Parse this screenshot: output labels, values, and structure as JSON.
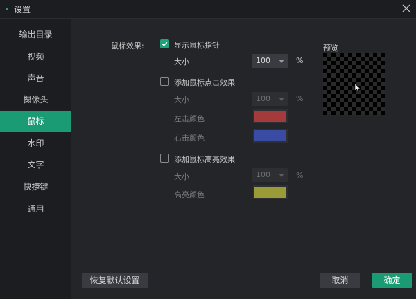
{
  "window": {
    "title": "设置"
  },
  "sidebar": {
    "items": [
      {
        "label": "输出目录"
      },
      {
        "label": "视频"
      },
      {
        "label": "声音"
      },
      {
        "label": "摄像头"
      },
      {
        "label": "鼠标",
        "active": true
      },
      {
        "label": "水印"
      },
      {
        "label": "文字"
      },
      {
        "label": "快捷键"
      },
      {
        "label": "通用"
      }
    ]
  },
  "mouse": {
    "section_label": "鼠标效果:",
    "show_pointer": {
      "label": "显示鼠标指针",
      "checked": true,
      "size_label": "大小",
      "size_value": "100",
      "unit": "%"
    },
    "click_effect": {
      "label": "添加鼠标点击效果",
      "checked": false,
      "size_label": "大小",
      "size_value": "100",
      "unit": "%",
      "left_color_label": "左击颜色",
      "left_color": "#a33a3c",
      "right_color_label": "右击颜色",
      "right_color": "#3a4ba3"
    },
    "highlight_effect": {
      "label": "添加鼠标高亮效果",
      "checked": false,
      "size_label": "大小",
      "size_value": "100",
      "unit": "%",
      "color_label": "高亮颜色",
      "color": "#9a9a36"
    }
  },
  "preview": {
    "label": "预览"
  },
  "footer": {
    "reset_label": "恢复默认设置",
    "cancel_label": "取消",
    "ok_label": "确定"
  },
  "colors": {
    "accent": "#1b9b73"
  }
}
